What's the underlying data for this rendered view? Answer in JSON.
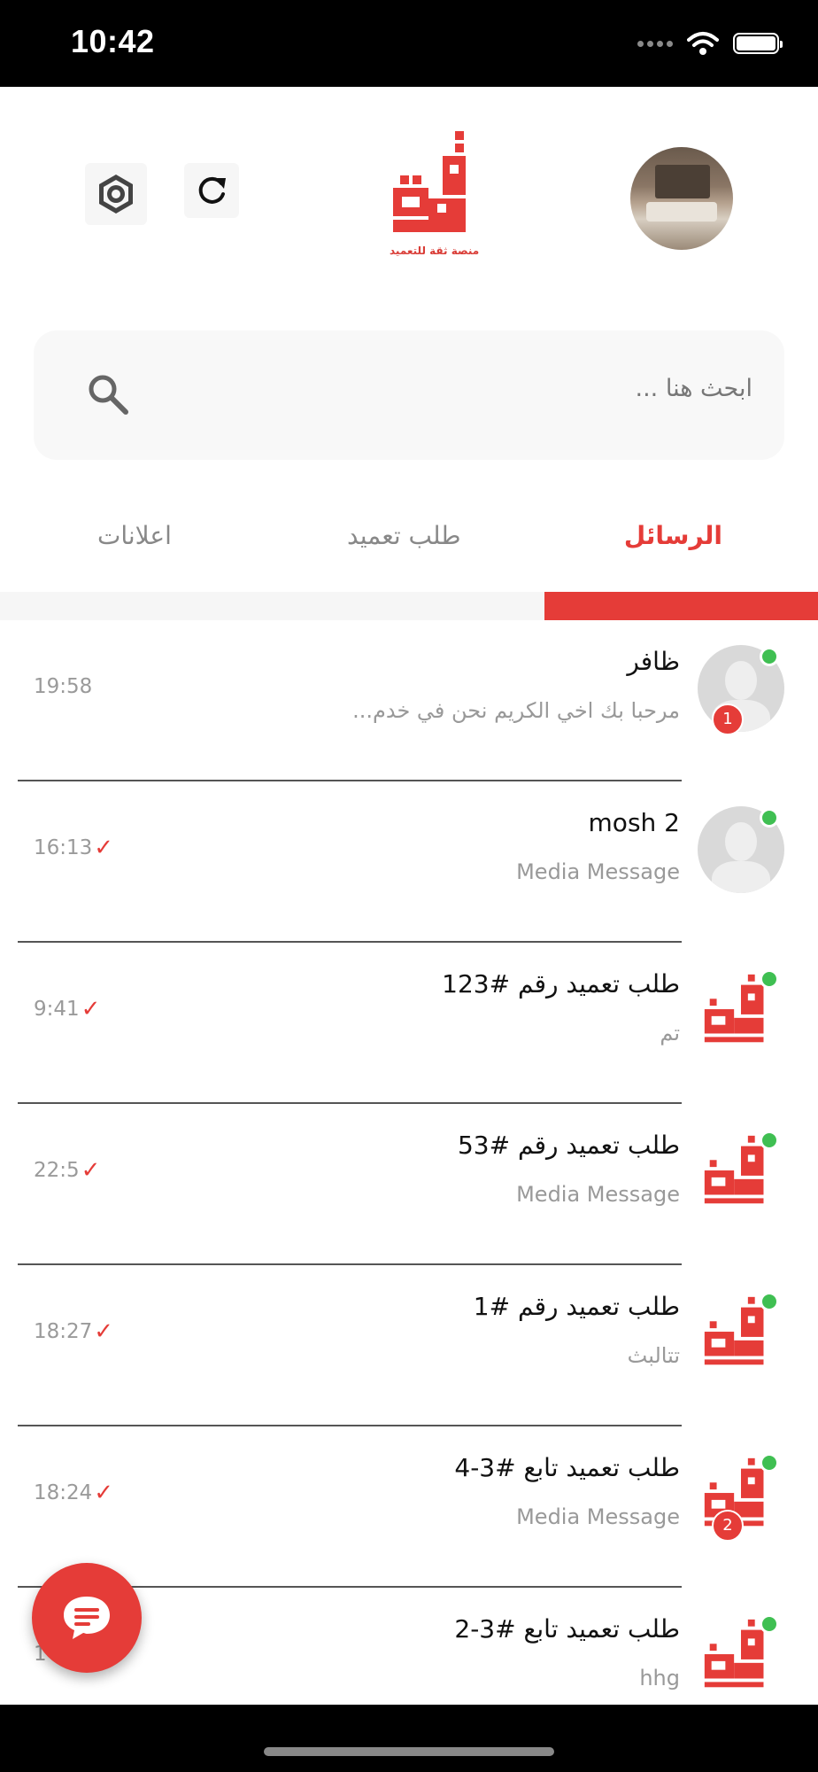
{
  "status_bar": {
    "time": "10:42"
  },
  "header": {
    "logo_caption": "منصة ثقة للتعميد"
  },
  "search": {
    "placeholder": "ابحث هنا ..."
  },
  "tabs": [
    {
      "label": "الرسائل",
      "active": true
    },
    {
      "label": "طلب تعميد",
      "active": false
    },
    {
      "label": "اعلانات",
      "active": false
    }
  ],
  "chats": [
    {
      "title": "ظافر",
      "preview": "مرحبا بك اخي الكريم نحن في خدم...",
      "time": "19:58",
      "read": false,
      "unread": "1",
      "avatar": "person-icon",
      "online": true
    },
    {
      "title": "mosh 2",
      "preview": "Media Message",
      "time": "16:13",
      "read": true,
      "unread": "",
      "avatar": "person-icon",
      "online": true
    },
    {
      "title": "طلب تعميد رقم #123",
      "preview": "تم",
      "time": "9:41",
      "read": true,
      "unread": "",
      "avatar": "logo-icon",
      "online": true
    },
    {
      "title": "طلب تعميد رقم #53",
      "preview": "Media Message",
      "time": "22:5",
      "read": true,
      "unread": "",
      "avatar": "logo-icon",
      "online": true
    },
    {
      "title": "طلب تعميد رقم #1",
      "preview": "تتالبث",
      "time": "18:27",
      "read": true,
      "unread": "",
      "avatar": "logo-icon",
      "online": true
    },
    {
      "title": "طلب تعميد تابع #3-4",
      "preview": "Media Message",
      "time": "18:24",
      "read": true,
      "unread": "2",
      "avatar": "logo-icon",
      "online": true
    },
    {
      "title": "طلب تعميد تابع #3-2",
      "preview": "hhg",
      "time": "1",
      "read": true,
      "unread": "",
      "avatar": "logo-icon",
      "online": true
    }
  ],
  "colors": {
    "accent": "#e53c38",
    "online": "#3fbf52"
  }
}
